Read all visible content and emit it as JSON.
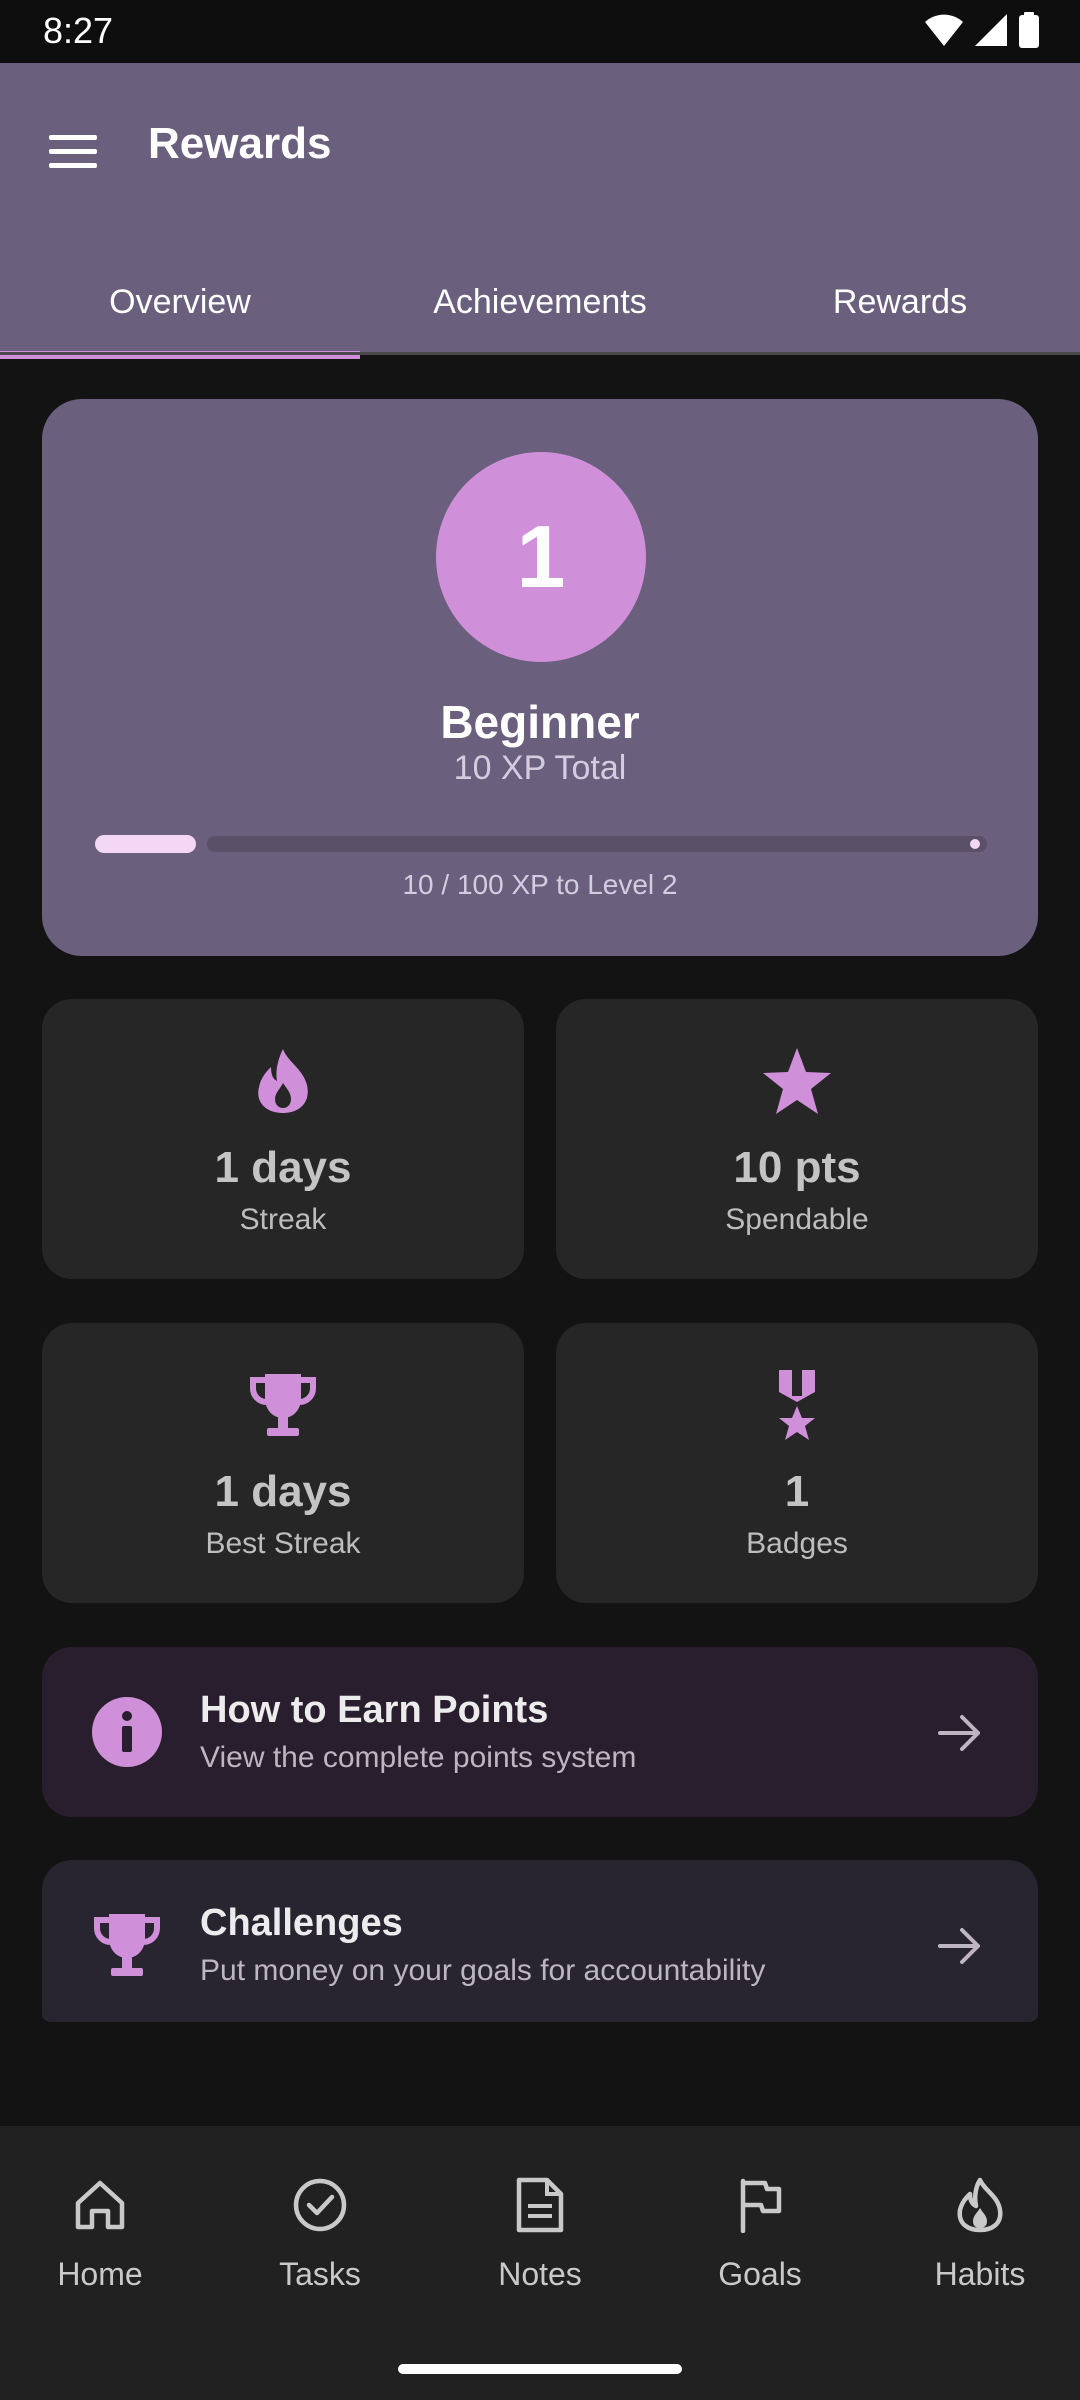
{
  "status_bar": {
    "time": "8:27"
  },
  "app_bar": {
    "title": "Rewards"
  },
  "tabs": [
    {
      "label": "Overview",
      "active": true
    },
    {
      "label": "Achievements",
      "active": false
    },
    {
      "label": "Rewards",
      "active": false
    }
  ],
  "level_card": {
    "level": "1",
    "name": "Beginner",
    "xp_total": "10 XP Total",
    "progress_fraction": 0.1,
    "progress_label": "10 / 100 XP to Level 2"
  },
  "stats": [
    {
      "icon": "flame-icon",
      "value": "1 days",
      "label": "Streak"
    },
    {
      "icon": "star-icon",
      "value": "10 pts",
      "label": "Spendable"
    },
    {
      "icon": "trophy-icon",
      "value": "1 days",
      "label": "Best Streak"
    },
    {
      "icon": "medal-icon",
      "value": "1",
      "label": "Badges"
    }
  ],
  "info_card": {
    "title": "How to Earn Points",
    "subtitle": "View the complete points system"
  },
  "challenges_card": {
    "title": "Challenges",
    "subtitle": "Put money on your goals for accountability"
  },
  "bottom_nav": [
    {
      "icon": "home-icon",
      "label": "Home"
    },
    {
      "icon": "check-circle-icon",
      "label": "Tasks"
    },
    {
      "icon": "note-icon",
      "label": "Notes"
    },
    {
      "icon": "flag-icon",
      "label": "Goals"
    },
    {
      "icon": "flame-outline-icon",
      "label": "Habits"
    }
  ],
  "colors": {
    "accent": "#cf8fd9",
    "header_bg": "#6a5f7d",
    "card_bg": "#262626",
    "background": "#131313"
  }
}
